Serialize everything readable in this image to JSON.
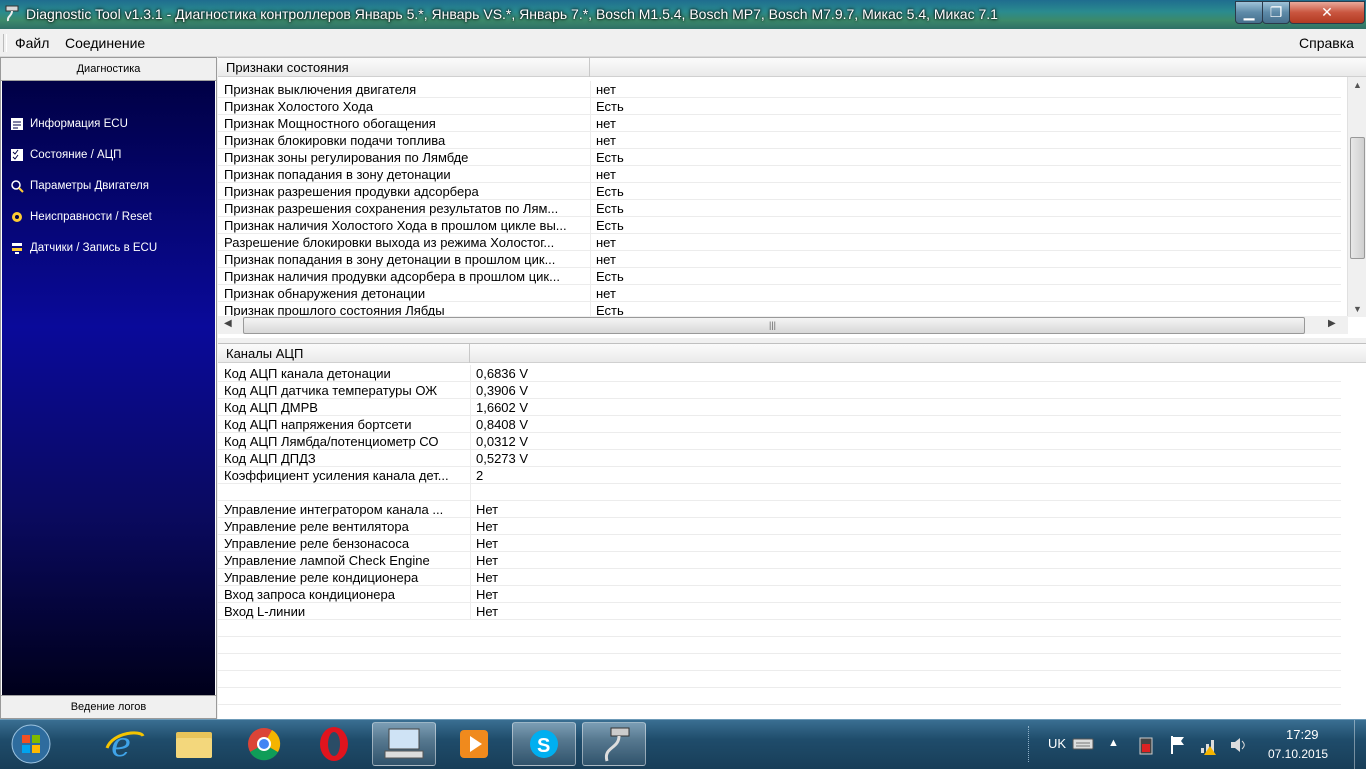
{
  "window": {
    "title": "Diagnostic Tool v1.3.1 - Диагностика контроллеров Январь 5.*, Январь VS.*, Январь 7.*, Bosch M1.5.4, Bosch MP7, Bosch M7.9.7, Микас 5.4, Микас 7.1"
  },
  "menu": {
    "file": "Файл",
    "connection": "Соединение",
    "help": "Справка"
  },
  "sidebar": {
    "header": "Диагностика",
    "items": [
      {
        "label": "Информация ECU"
      },
      {
        "label": "Состояние / АЦП"
      },
      {
        "label": "Параметры Двигателя"
      },
      {
        "label": "Неисправности / Reset"
      },
      {
        "label": "Датчики / Запись в ECU"
      }
    ],
    "footer": "Ведение логов"
  },
  "status_panel": {
    "header": "Признаки состояния",
    "rows": [
      {
        "name": "Признак выключения двигателя",
        "value": "нет"
      },
      {
        "name": "Признак Холостого Хода",
        "value": "Есть"
      },
      {
        "name": "Признак Мощностного обогащения",
        "value": "нет"
      },
      {
        "name": "Признак блокировки подачи топлива",
        "value": "нет"
      },
      {
        "name": "Признак зоны регулирования по Лямбде",
        "value": "Есть"
      },
      {
        "name": "Признак попадания в зону детонации",
        "value": "нет"
      },
      {
        "name": "Признак разрешения продувки адсорбера",
        "value": "Есть"
      },
      {
        "name": "Признак разрешения сохранения результатов по Лям...",
        "value": "Есть"
      },
      {
        "name": "Признак наличия Холостого Хода в прошлом цикле вы...",
        "value": "Есть"
      },
      {
        "name": "Разрешение блокировки выхода из режима Холостог...",
        "value": "нет"
      },
      {
        "name": "Признак попадания в зону детонации в прошлом цик...",
        "value": "нет"
      },
      {
        "name": "Признак наличия продувки адсорбера в прошлом цик...",
        "value": "Есть"
      },
      {
        "name": "Признак обнаружения детонации",
        "value": "нет"
      },
      {
        "name": "Признак прошлого состояния Лябды",
        "value": "Есть"
      }
    ]
  },
  "adc_panel": {
    "header": "Каналы АЦП",
    "rows": [
      {
        "name": "Код АЦП канала детонации",
        "value": "0,6836 V"
      },
      {
        "name": "Код АЦП датчика температуры ОЖ",
        "value": "0,3906 V"
      },
      {
        "name": "Код АЦП ДМРВ",
        "value": "1,6602 V"
      },
      {
        "name": "Код АЦП напряжения бортсети",
        "value": "0,8408 V"
      },
      {
        "name": "Код АЦП Лямбда/потенциометр СО",
        "value": "0,0312 V"
      },
      {
        "name": "Код АЦП ДПДЗ",
        "value": "0,5273 V"
      },
      {
        "name": "Коэффициент усиления канала дет...",
        "value": "2"
      },
      {
        "name": "",
        "value": ""
      },
      {
        "name": "Управление интегратором канала ...",
        "value": "Нет"
      },
      {
        "name": "Управление реле вентилятора",
        "value": "Нет"
      },
      {
        "name": "Управление реле бензонасоса",
        "value": "Нет"
      },
      {
        "name": "Управление лампой Check Engine",
        "value": "Нет"
      },
      {
        "name": "Управление реле кондиционера",
        "value": "Нет"
      },
      {
        "name": "Вход запроса кондиционера",
        "value": "Нет"
      },
      {
        "name": "Вход L-линии",
        "value": "Нет"
      }
    ]
  },
  "taskbar": {
    "language": "UK",
    "time": "17:29",
    "date": "07.10.2015"
  }
}
